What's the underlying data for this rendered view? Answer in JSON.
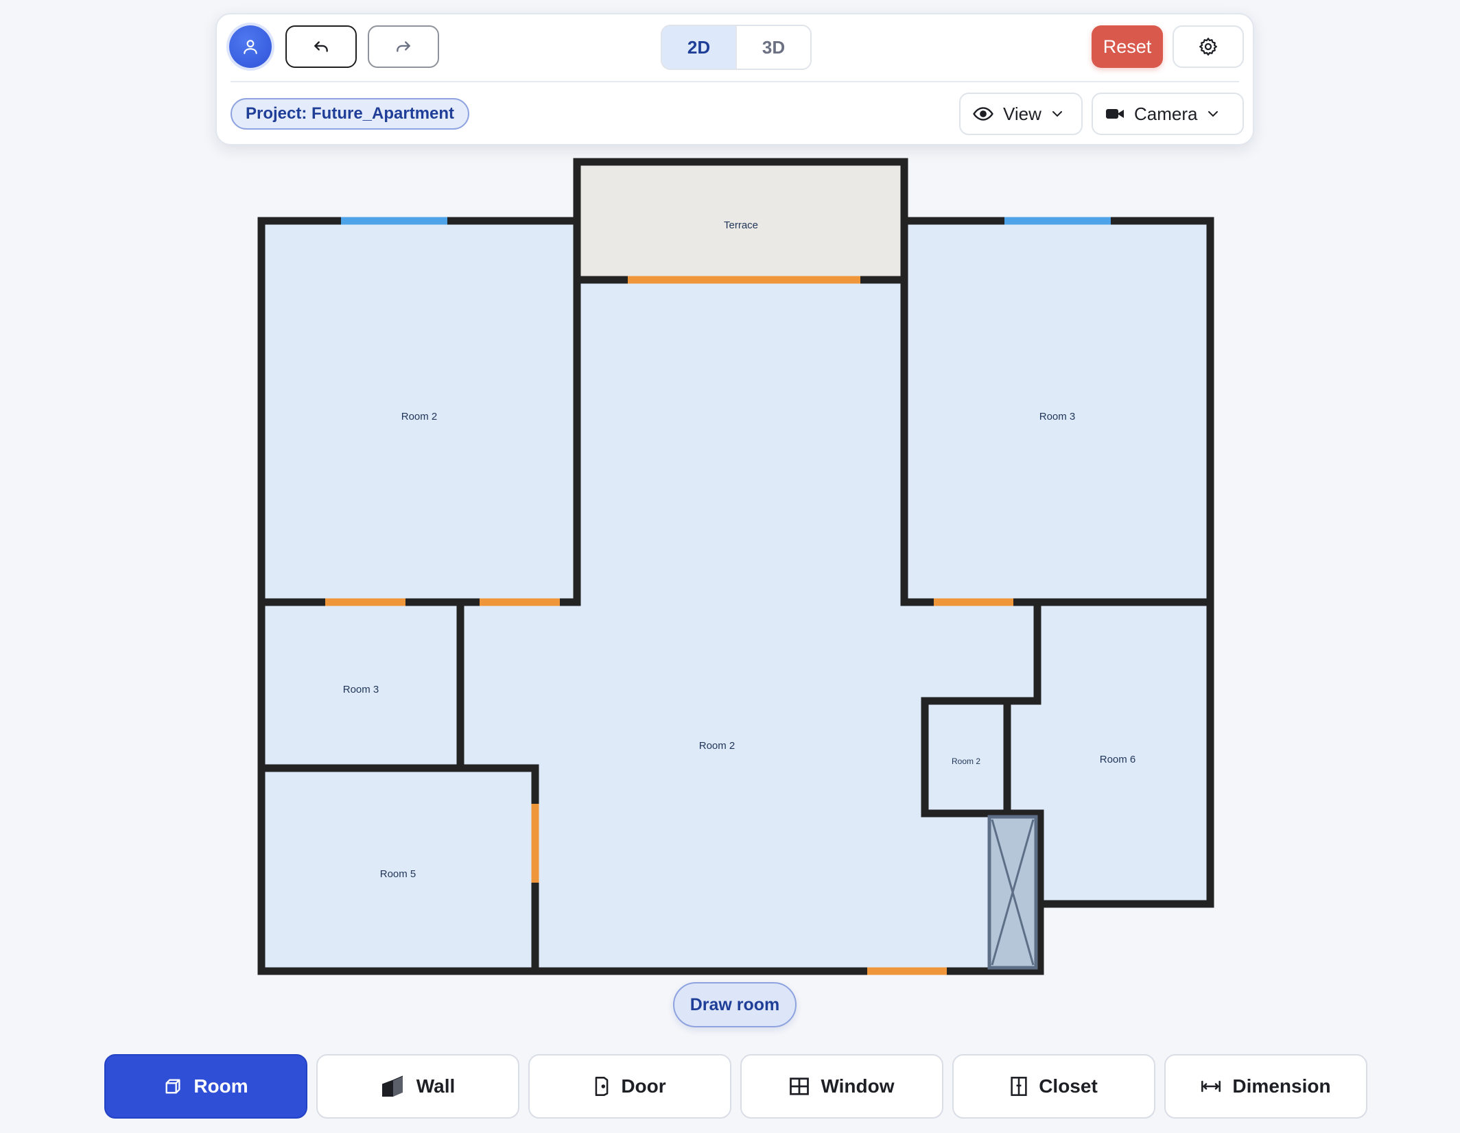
{
  "header": {
    "undo_icon": "undo-icon",
    "redo_icon": "redo-icon",
    "view_modes": [
      {
        "label": "2D",
        "active": true
      },
      {
        "label": "3D",
        "active": false
      }
    ],
    "reset_label": "Reset",
    "project_label": "Project: Future_Apartment",
    "view_label": "View",
    "camera_label": "Camera"
  },
  "floorplan": {
    "rooms": {
      "terrace": "Terrace",
      "room_2_left": "Room 2",
      "room_3_right": "Room 3",
      "room_3_small": "Room 3",
      "room_2_center": "Room 2",
      "room_2_small": "Room 2",
      "room_6": "Room 6",
      "room_5": "Room 5"
    },
    "colors": {
      "wall": "#232323",
      "room_fill": "#deeaf8",
      "terrace_fill": "#ebe9e6",
      "door": "#f0963a",
      "window": "#4ea3e8",
      "closet": "#b4c6d8"
    }
  },
  "draw_room_label": "Draw room",
  "toolbar": {
    "room": "Room",
    "wall": "Wall",
    "door": "Door",
    "window": "Window",
    "closet": "Closet",
    "dimension": "Dimension",
    "active": "Room"
  }
}
